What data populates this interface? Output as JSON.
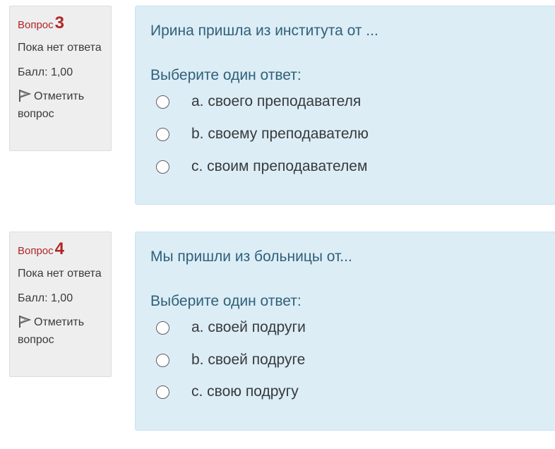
{
  "questions": [
    {
      "label": "Вопрос",
      "number": "3",
      "state": "Пока нет ответа",
      "grade": "Балл: 1,00",
      "flag_label": "Отметить вопрос",
      "text": "Ирина пришла из института от ...",
      "prompt": "Выберите один ответ:",
      "options": [
        "a. своего преподавателя",
        "b. своему преподавателю",
        "c. своим преподавателем"
      ]
    },
    {
      "label": "Вопрос",
      "number": "4",
      "state": "Пока нет ответа",
      "grade": "Балл: 1,00",
      "flag_label": "Отметить вопрос",
      "text": "Мы пришли из больницы от...",
      "prompt": "Выберите один ответ:",
      "options": [
        "a. своей подруги",
        "b. своей подруге",
        "c. свою подругу"
      ]
    }
  ],
  "colors": {
    "accent": "#b02626",
    "info_bg": "#eeeeef",
    "content_bg": "#dcedf6",
    "question_text": "#2f6079"
  },
  "icons": {
    "flag": "flag-icon"
  }
}
